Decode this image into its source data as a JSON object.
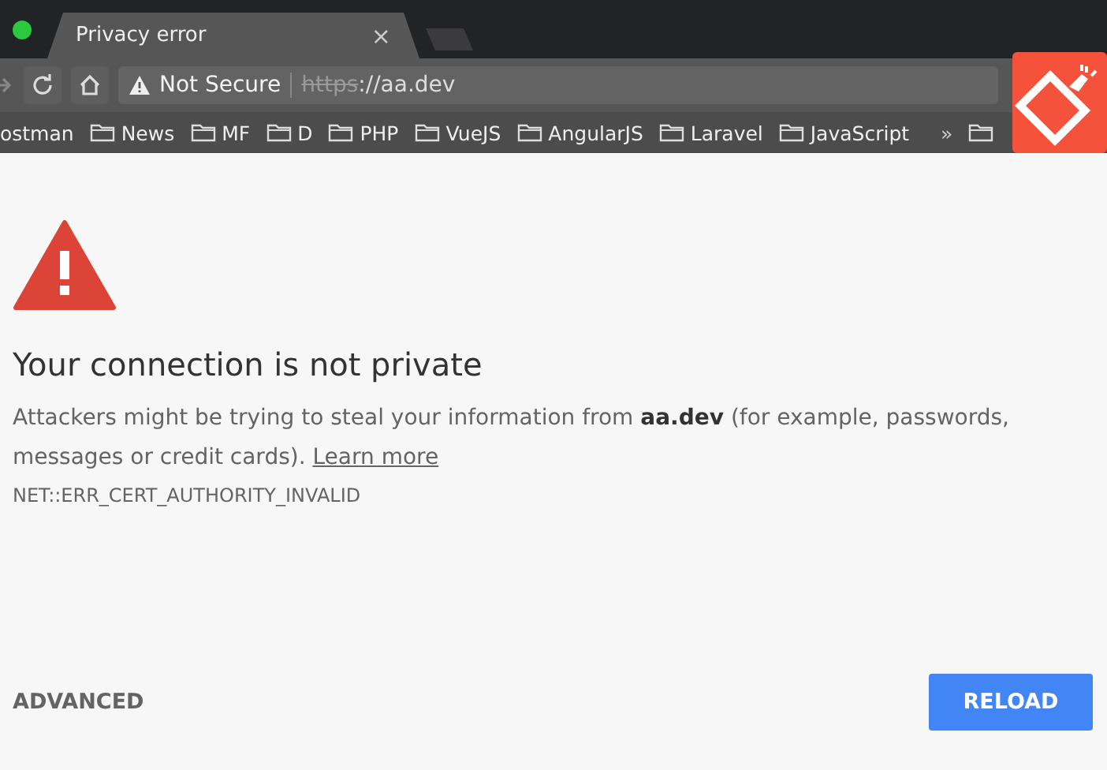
{
  "tab": {
    "title": "Privacy error",
    "close": "×"
  },
  "address_bar": {
    "security": "Not Secure",
    "scheme": "https",
    "rest": "://aa.dev"
  },
  "bookmarks": [
    {
      "label": "ostman",
      "folder": false
    },
    {
      "label": "News",
      "folder": true
    },
    {
      "label": "MF",
      "folder": true
    },
    {
      "label": "D",
      "folder": true
    },
    {
      "label": "PHP",
      "folder": true
    },
    {
      "label": "VueJS",
      "folder": true
    },
    {
      "label": "AngularJS",
      "folder": true
    },
    {
      "label": "Laravel",
      "folder": true
    },
    {
      "label": "JavaScript",
      "folder": true
    }
  ],
  "bookmarks_overflow": "»",
  "bookmark_cut": {
    "folder": true
  },
  "error": {
    "heading": "Your connection is not private",
    "message": "Attackers might be trying to steal your information from **aa.dev** (for example, passwords, messages or credit cards).",
    "link": "Learn more",
    "code": "NET::ERR_CERT_AUTHORITY_INVALID"
  },
  "buttons": {
    "advanced": "ADVANCED",
    "reload": "RELOAD"
  }
}
